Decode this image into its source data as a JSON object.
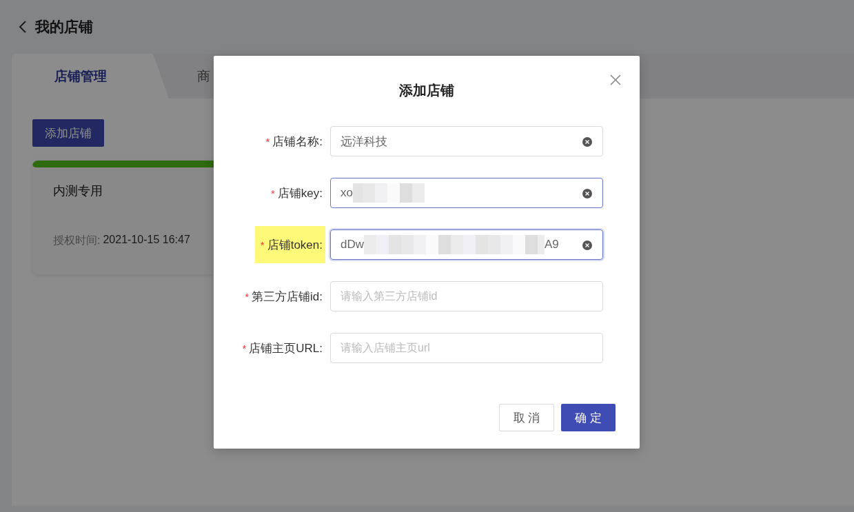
{
  "page": {
    "title": "我的店铺"
  },
  "tabs": [
    {
      "label": "店铺管理",
      "selected": true
    },
    {
      "label": "商",
      "selected": false
    }
  ],
  "add_button": "添加店铺",
  "store_card": {
    "name": "内测专用",
    "auth_label": "授权时间:",
    "auth_time": "2021-10-15 16:47"
  },
  "dialog": {
    "title": "添加店铺",
    "fields": [
      {
        "asterisk": "*",
        "label": "店铺名称:",
        "highlighted": false,
        "hovered": false,
        "focused": false,
        "value": "远洋科技",
        "clearable": true
      },
      {
        "asterisk": "*",
        "label": "店铺key:",
        "highlighted": false,
        "hovered": true,
        "focused": false,
        "value": "xo",
        "redacted": true,
        "clearable": true
      },
      {
        "asterisk": "*",
        "label": "店铺token:",
        "highlighted": true,
        "hovered": false,
        "focused": true,
        "value": "dDw",
        "value_end": "A9",
        "redacted": true,
        "clearable": true
      },
      {
        "asterisk": "*",
        "label": "第三方店铺id:",
        "highlighted": false,
        "hovered": false,
        "focused": false,
        "placeholder": "请输入第三方店铺id"
      },
      {
        "asterisk": "*",
        "label": "店铺主页URL:",
        "highlighted": false,
        "hovered": false,
        "focused": false,
        "placeholder": "请输入店铺主页url"
      }
    ],
    "cancel": "取 消",
    "ok": "确 定"
  }
}
